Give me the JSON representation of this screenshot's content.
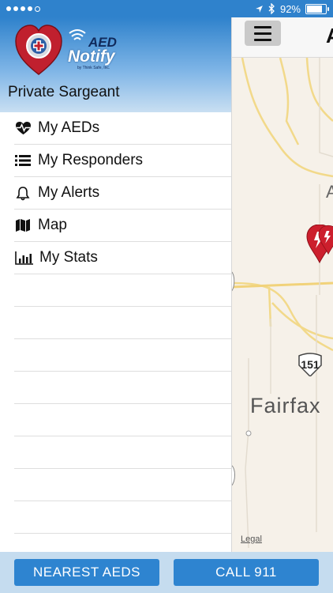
{
  "status_bar": {
    "signal_bars": 4,
    "battery_percent_text": "92%",
    "battery_level": 0.92
  },
  "drawer": {
    "app_logo": {
      "line1": "AED",
      "line2": "Notify",
      "tagline": "by Think Safe, Inc."
    },
    "user_name": "Private Sargeant",
    "menu": [
      {
        "label": "My AEDs",
        "icon": "heartbeat-icon"
      },
      {
        "label": "My Responders",
        "icon": "list-icon"
      },
      {
        "label": "My Alerts",
        "icon": "bell-icon"
      },
      {
        "label": "Map",
        "icon": "map-icon"
      },
      {
        "label": "My Stats",
        "icon": "bar-chart-icon"
      }
    ]
  },
  "map": {
    "nav_title_fragment": "A",
    "place_label": "Fairfax",
    "road_shield": "151",
    "side_label": "A",
    "legal_link": "Legal",
    "marker_color": "#cc1f2d"
  },
  "bottom_bar": {
    "nearest_label": "NEAREST AEDS",
    "call_label": "CALL 911"
  },
  "colors": {
    "accent": "#2e84d0",
    "status_bar": "#2f82cc"
  }
}
